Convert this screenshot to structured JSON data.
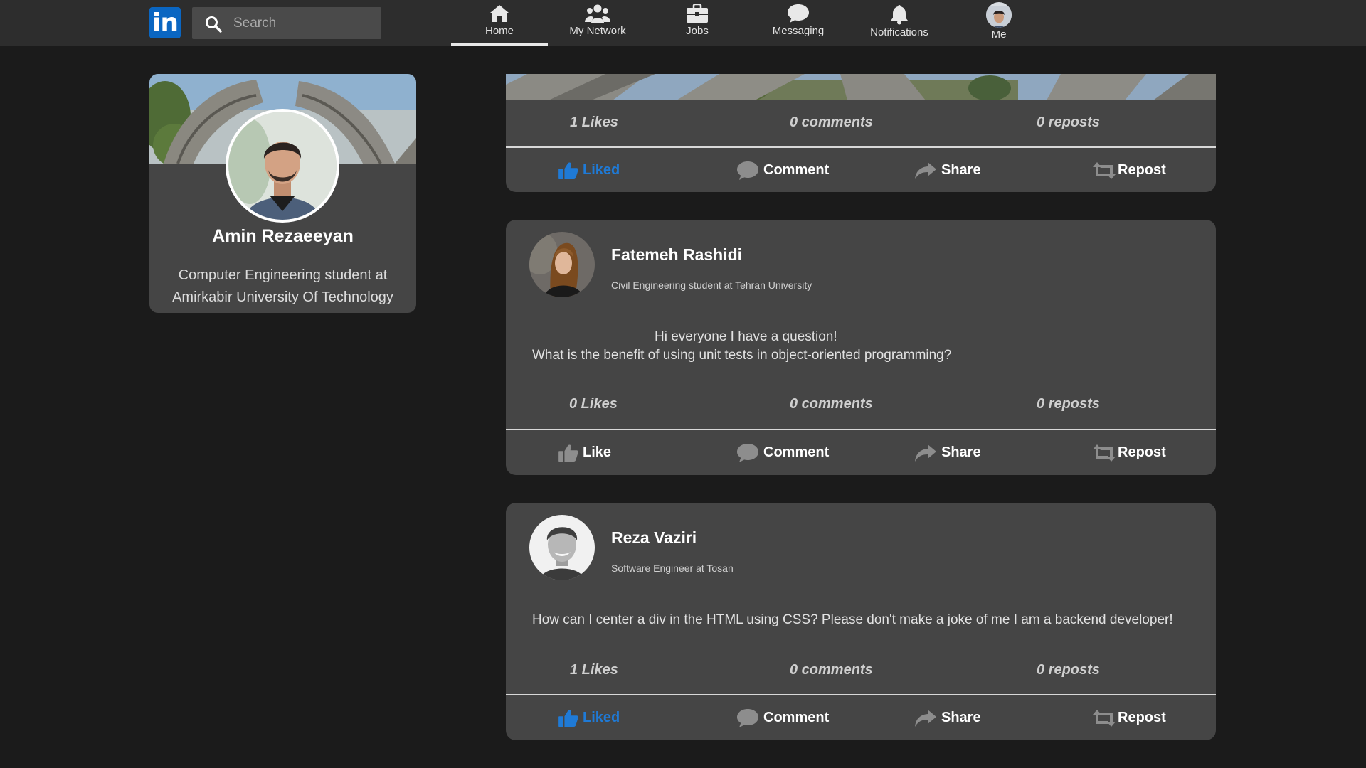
{
  "nav": {
    "logo_text": "in",
    "search_placeholder": "Search",
    "items": [
      {
        "label": "Home",
        "icon": "home-icon",
        "active": true
      },
      {
        "label": "My Network",
        "icon": "network-icon"
      },
      {
        "label": "Jobs",
        "icon": "briefcase-icon"
      },
      {
        "label": "Messaging",
        "icon": "chat-bubble-icon"
      },
      {
        "label": "Notifications",
        "icon": "bell-icon"
      },
      {
        "label": "Me",
        "icon": "avatar"
      }
    ]
  },
  "profile": {
    "name": "Amin Rezaeeyan",
    "headline": "Computer Engineering student at Amirkabir University Of Technology"
  },
  "colors": {
    "background": "#1b1b1b",
    "navbar": "#2d2d2d",
    "card": "#454545",
    "liked_accent": "#1f7ad6",
    "brand": "#0a66c2"
  },
  "posts": [
    {
      "likes": "1 Likes",
      "comments": "0 comments",
      "reposts": "0 reposts",
      "like_label": "Liked",
      "liked": true,
      "comment_label": "Comment",
      "share_label": "Share",
      "repost_label": "Repost"
    },
    {
      "author": "Fatemeh Rashidi",
      "headline": "Civil Engineering student at Tehran University",
      "body_line1": "Hi everyone I have a question!",
      "body_line2": "What is the benefit of using unit tests in object-oriented programming?",
      "likes": "0 Likes",
      "comments": "0 comments",
      "reposts": "0 reposts",
      "like_label": "Like",
      "liked": false,
      "comment_label": "Comment",
      "share_label": "Share",
      "repost_label": "Repost"
    },
    {
      "author": "Reza Vaziri",
      "headline": "Software Engineer at Tosan",
      "body_line1": "How can I center a div in the HTML using CSS? Please don't make a joke of me I am a backend developer!",
      "likes": "1 Likes",
      "comments": "0 comments",
      "reposts": "0 reposts",
      "like_label": "Liked",
      "liked": true,
      "comment_label": "Comment",
      "share_label": "Share",
      "repost_label": "Repost"
    }
  ]
}
